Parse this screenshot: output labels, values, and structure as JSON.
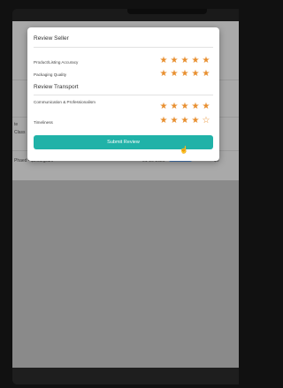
{
  "modal": {
    "seller_title": "Review Seller",
    "seller_criteria": [
      {
        "label": "Product/Listing Accuracy",
        "rating": 5
      },
      {
        "label": "Packaging Quality",
        "rating": 5
      }
    ],
    "transport_title": "Review Transport",
    "transport_criteria": [
      {
        "label": "Communication & Professionalism",
        "rating": 5
      },
      {
        "label": "Timeliness",
        "rating": 4
      }
    ],
    "max_rating": 5,
    "submit_label": "Submit Review"
  },
  "background": {
    "row_price": "Phaed • $6.00/gram",
    "row_date": "01-16-2026",
    "row_right": "$6",
    "left_text_1": "te",
    "left_text_2": "Class"
  },
  "colors": {
    "accent": "#20b2a8",
    "star": "#e88f2f"
  },
  "icons": {
    "star_filled": "star-filled-icon",
    "star_empty": "star-outline-icon",
    "cursor": "hand-cursor-icon"
  }
}
